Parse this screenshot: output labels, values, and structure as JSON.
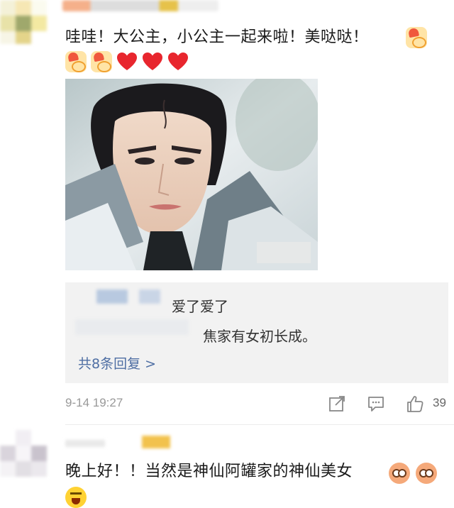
{
  "comment1": {
    "text": "哇哇！大公主，小公主一起来啦！美哒哒！",
    "emojis": [
      "love-emoji",
      "love-emoji",
      "love-emoji",
      "red-heart",
      "red-heart",
      "red-heart"
    ],
    "replies": [
      {
        "text": "爱了爱了"
      },
      {
        "text": "焦家有女初长成。"
      }
    ],
    "more_replies": "共8条回复 >",
    "time": "9-14 19:27",
    "like_count": "39"
  },
  "comment2": {
    "text": "晚上好！！当然是神仙阿罐家的神仙美女",
    "emojis": [
      "shocked-face-emoji",
      "shocked-face-emoji",
      "crying-emoji"
    ]
  },
  "colors": {
    "link": "#4e6ea3",
    "reply_bg": "#f2f2f2",
    "meta_text": "#999999",
    "heart": "#e8262e"
  },
  "icons": {
    "share": "share-icon",
    "reply": "comment-icon",
    "like": "thumbs-up-icon"
  }
}
